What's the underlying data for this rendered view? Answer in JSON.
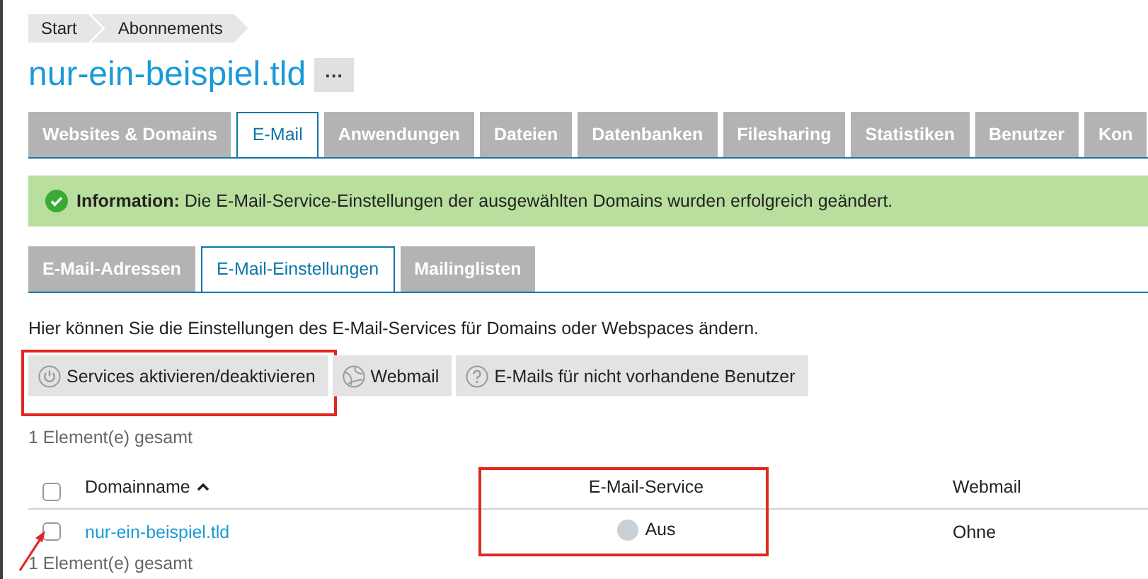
{
  "breadcrumb": [
    "Start",
    "Abonnements"
  ],
  "title": "nur-ein-beispiel.tld",
  "title_menu": "···",
  "tabs": [
    {
      "label": "Websites & Domains",
      "selected": false
    },
    {
      "label": "E-Mail",
      "selected": true
    },
    {
      "label": "Anwendungen",
      "selected": false
    },
    {
      "label": "Dateien",
      "selected": false
    },
    {
      "label": "Datenbanken",
      "selected": false
    },
    {
      "label": "Filesharing",
      "selected": false
    },
    {
      "label": "Statistiken",
      "selected": false
    },
    {
      "label": "Benutzer",
      "selected": false
    },
    {
      "label": "Kon",
      "selected": false
    }
  ],
  "message": {
    "kind": "success",
    "text": "**Information:** Die E-Mail-Service-Einstellungen der ausgewählten Domains wurden erfolgreich geändert."
  },
  "subtabs": [
    {
      "label": "E-Mail-Adressen",
      "selected": false
    },
    {
      "label": "E-Mail-Einstellungen",
      "selected": true
    },
    {
      "label": "Mailinglisten",
      "selected": false
    }
  ],
  "description": "Hier können Sie die Einstellungen des E-Mail-Services für Domains oder Webspaces ändern.",
  "toolbar": [
    {
      "kind": "power",
      "label": "Services aktivieren/deaktivieren",
      "highlighted": true
    },
    {
      "kind": "globe",
      "label": "Webmail"
    },
    {
      "kind": "help",
      "label": "E-Mails für nicht vorhandene Benutzer"
    }
  ],
  "count_top": "1 Element(e) gesamt",
  "table": {
    "all_checked": false,
    "columns": [
      {
        "label": "Domainname",
        "sorted": true
      },
      {
        "label": "E-Mail-Service",
        "highlighted": true
      },
      {
        "label": "Webmail"
      }
    ],
    "rows": [
      {
        "checked": false,
        "pointed": true,
        "domain": "nur-ein-beispiel.tld",
        "service_on": false,
        "service": "Aus",
        "webmail": "Ohne"
      }
    ]
  },
  "count_bottom": "1 Element(e) gesamt"
}
